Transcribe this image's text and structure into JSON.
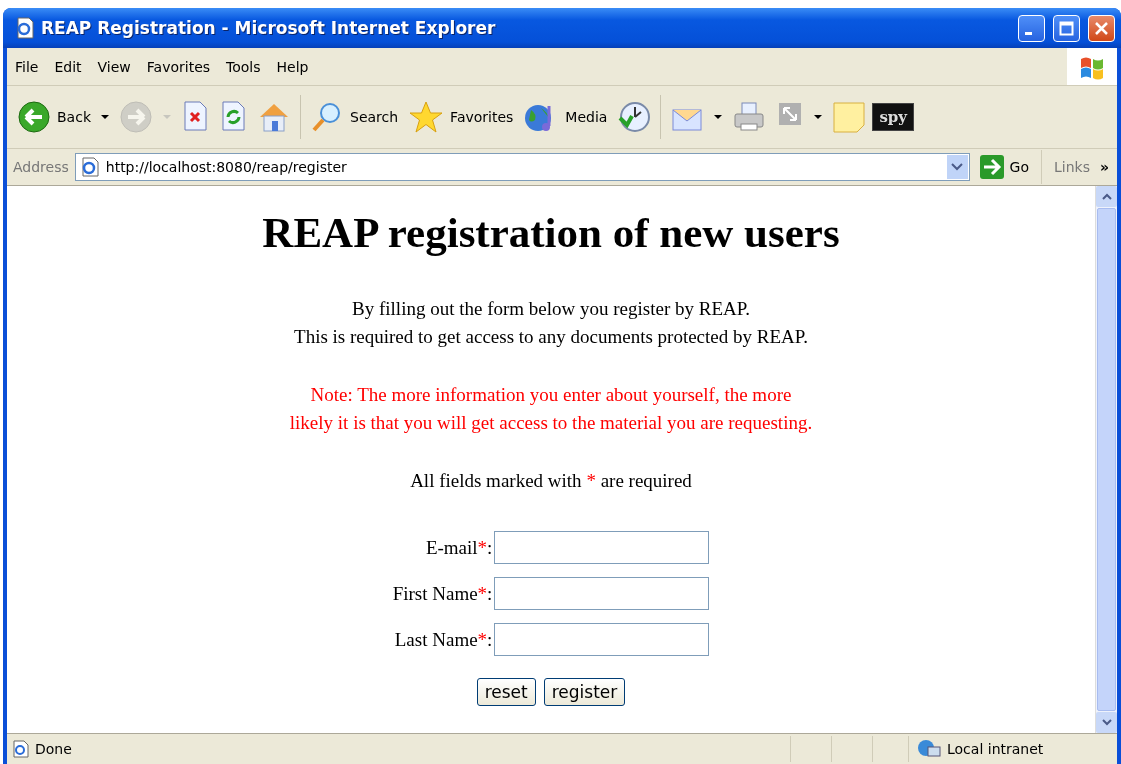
{
  "window": {
    "title": "REAP Registration - Microsoft Internet Explorer"
  },
  "menu": [
    "File",
    "Edit",
    "View",
    "Favorites",
    "Tools",
    "Help"
  ],
  "toolbar": [
    {
      "label": "Back",
      "dropdown": true,
      "disabled": false
    },
    {
      "dropdown": true,
      "disabled": true
    },
    {
      "dropdown": false,
      "disabled": false
    },
    {
      "dropdown": false,
      "disabled": false
    },
    {
      "dropdown": false,
      "disabled": false
    },
    {
      "label": "Search",
      "dropdown": false,
      "disabled": false
    },
    {
      "label": "Favorites",
      "dropdown": false,
      "disabled": false
    },
    {
      "label": "Media",
      "dropdown": false,
      "disabled": false
    },
    {
      "dropdown": false,
      "disabled": false
    },
    {
      "dropdown": true,
      "disabled": false
    },
    {
      "dropdown": false,
      "disabled": false
    },
    {
      "dropdown": true,
      "disabled": false
    },
    {
      "dropdown": false,
      "disabled": false
    },
    {
      "label": "spy",
      "dropdown": false,
      "disabled": false
    }
  ],
  "address_bar": {
    "label": "Address",
    "url": "http://localhost:8080/reap/register",
    "go": "Go",
    "links": "Links",
    "more": "»"
  },
  "page": {
    "heading": "REAP registration of new users",
    "intro": [
      "By filling out the form below you register by REAP.",
      "This is required to get access to any documents protected by REAP."
    ],
    "note": [
      "Note: The more information you enter about yourself, the more",
      "likely it is that you will get access to the material you are requesting."
    ],
    "required_note": {
      "before": "All fields marked with",
      "mark": "*",
      "after": "are required"
    },
    "fields": [
      {
        "label": "E-mail",
        "mark": "*",
        "colon": ":"
      },
      {
        "label": "First Name",
        "mark": "*",
        "colon": ":"
      },
      {
        "label": "Last Name",
        "mark": "*",
        "colon": ":"
      }
    ],
    "buttons": [
      "reset",
      "register"
    ]
  },
  "status_bar": {
    "text": "Done",
    "zone": "Local intranet"
  }
}
